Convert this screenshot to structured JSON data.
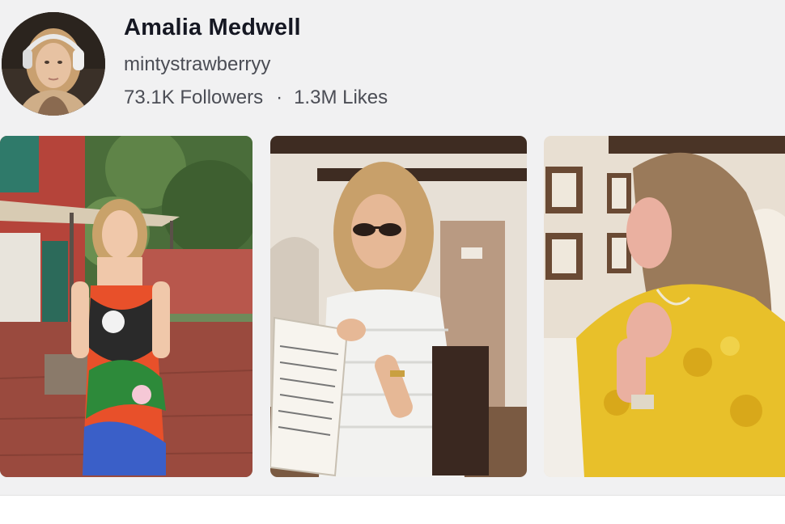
{
  "profile": {
    "name": "Amalia Medwell",
    "handle": "mintystrawberryy",
    "followers": "73.1K Followers",
    "separator": "·",
    "likes": "1.3M Likes"
  },
  "videos": [
    {
      "scene": "woman in colorful swirl-print dress on terracotta patio"
    },
    {
      "scene": "woman in sunglasses holding a menu indoors"
    },
    {
      "scene": "woman in yellow dress with hands on chest"
    }
  ],
  "colors": {
    "name_text": "#161823",
    "secondary_text": "#4b4d55",
    "background": "#f1f1f2"
  }
}
